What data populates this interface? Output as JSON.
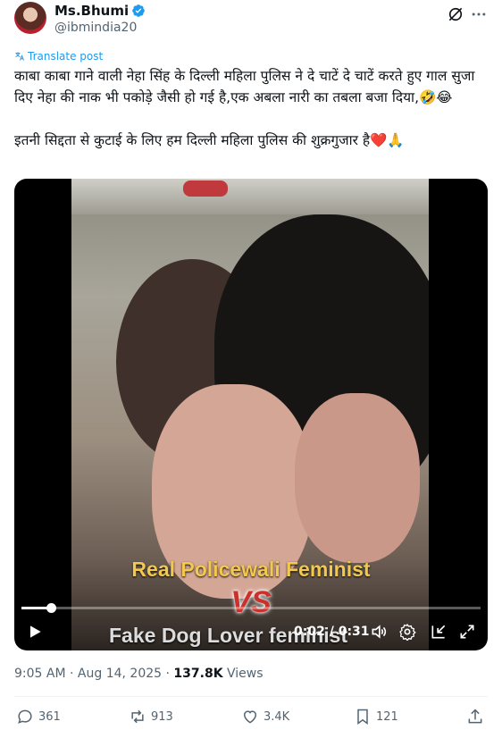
{
  "author": {
    "name": "Ms.Bhumi",
    "handle": "@ibmindia20",
    "verified": true,
    "avatar_icon": "avatar"
  },
  "header_icons": [
    "grok-icon",
    "more-icon"
  ],
  "translate_label": "Translate post",
  "post_text": "काबा काबा गाने वाली नेहा सिंह के दिल्ली महिला पुलिस ने दे चाटें दे चाटें करते हुए गाल सुजा दिए नेहा की नाक भी पकोड़े जैसी हो गई है,एक अबला नारी का तबला बजा दिया,🤣😂\n\nइतनी सिद्दता से कुटाई के लिए हम दिल्ली महिला पुलिस की शुक्रगुजार है❤️🙏",
  "video": {
    "caption_top": "Real Policewali Feminist",
    "caption_vs": "VS",
    "caption_bottom": "Fake Dog Lover feminist",
    "current_time": "0:02",
    "separator": "/",
    "duration": "0:31",
    "progress": 0.065,
    "controls": [
      "play-icon",
      "volume-icon",
      "settings-icon",
      "pip-icon",
      "fullscreen-icon"
    ]
  },
  "meta": {
    "time": "9:05 AM",
    "dot1": "·",
    "date": "Aug 14, 2025",
    "dot2": "·",
    "views_count": "137.8K",
    "views_label": "Views"
  },
  "actions": {
    "replies": "361",
    "reposts": "913",
    "likes": "3.4K",
    "bookmarks": "121"
  },
  "colors": {
    "accent": "#1d9bf0",
    "text": "#0f1419",
    "secondary": "#536471"
  }
}
